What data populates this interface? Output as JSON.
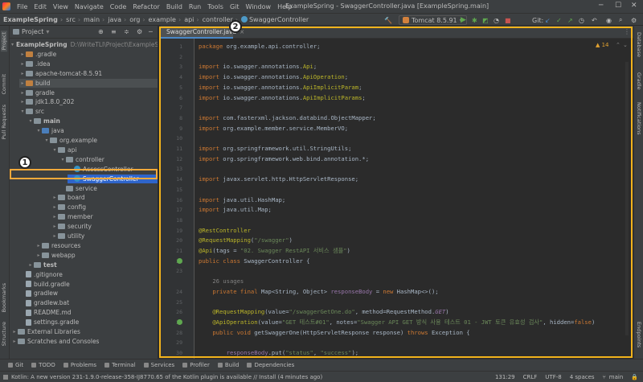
{
  "menu": {
    "items": [
      "File",
      "Edit",
      "View",
      "Navigate",
      "Code",
      "Refactor",
      "Build",
      "Run",
      "Tools",
      "Git",
      "Window",
      "Help"
    ],
    "window_title": "ExampleSpring - SwaggerController.java [ExampleSpring.main]"
  },
  "breadcrumbs": [
    "ExampleSpring",
    "src",
    "main",
    "java",
    "org",
    "example",
    "api",
    "controller",
    "SwaggerController"
  ],
  "toolbar": {
    "run_config": "Tomcat 8.5.91",
    "git_label": "Git:"
  },
  "project": {
    "title": "Project",
    "tree": [
      {
        "label": "ExampleSpring",
        "extra": "D:\\WriteTLI\\Project\\ExampleSpring",
        "depth": 0,
        "arrow": "▾",
        "icon": "folder",
        "bold": true
      },
      {
        "label": ".gradle",
        "depth": 1,
        "arrow": "▸",
        "icon": "folder-orange"
      },
      {
        "label": ".idea",
        "depth": 1,
        "arrow": "▸",
        "icon": "folder"
      },
      {
        "label": "apache-tomcat-8.5.91",
        "depth": 1,
        "arrow": "▸",
        "icon": "folder"
      },
      {
        "label": "build",
        "depth": 1,
        "arrow": "▸",
        "icon": "folder-orange",
        "selected": true
      },
      {
        "label": "gradle",
        "depth": 1,
        "arrow": "▸",
        "icon": "folder"
      },
      {
        "label": "jdk1.8.0_202",
        "depth": 1,
        "arrow": "▸",
        "icon": "folder"
      },
      {
        "label": "src",
        "depth": 1,
        "arrow": "▾",
        "icon": "folder"
      },
      {
        "label": "main",
        "depth": 2,
        "arrow": "▾",
        "icon": "folder",
        "bold": true
      },
      {
        "label": "java",
        "depth": 3,
        "arrow": "▾",
        "icon": "folder-blue"
      },
      {
        "label": "org.example",
        "depth": 4,
        "arrow": "▾",
        "icon": "folder"
      },
      {
        "label": "api",
        "depth": 5,
        "arrow": "▾",
        "icon": "folder"
      },
      {
        "label": "controller",
        "depth": 6,
        "arrow": "▾",
        "icon": "folder"
      },
      {
        "label": "AccessController",
        "depth": 7,
        "arrow": "",
        "icon": "class"
      },
      {
        "label": "SwaggerController",
        "depth": 7,
        "arrow": "",
        "icon": "class",
        "highlight": true
      },
      {
        "label": "service",
        "depth": 6,
        "arrow": "",
        "icon": "folder"
      },
      {
        "label": "board",
        "depth": 5,
        "arrow": "▸",
        "icon": "folder"
      },
      {
        "label": "config",
        "depth": 5,
        "arrow": "▸",
        "icon": "folder"
      },
      {
        "label": "member",
        "depth": 5,
        "arrow": "▸",
        "icon": "folder"
      },
      {
        "label": "security",
        "depth": 5,
        "arrow": "▸",
        "icon": "folder"
      },
      {
        "label": "utility",
        "depth": 5,
        "arrow": "▸",
        "icon": "folder"
      },
      {
        "label": "resources",
        "depth": 3,
        "arrow": "▸",
        "icon": "folder"
      },
      {
        "label": "webapp",
        "depth": 3,
        "arrow": "▸",
        "icon": "folder"
      },
      {
        "label": "test",
        "depth": 2,
        "arrow": "▸",
        "icon": "folder",
        "bold": true
      },
      {
        "label": ".gitignore",
        "depth": 1,
        "arrow": "",
        "icon": "file"
      },
      {
        "label": "build.gradle",
        "depth": 1,
        "arrow": "",
        "icon": "file"
      },
      {
        "label": "gradlew",
        "depth": 1,
        "arrow": "",
        "icon": "file"
      },
      {
        "label": "gradlew.bat",
        "depth": 1,
        "arrow": "",
        "icon": "file"
      },
      {
        "label": "README.md",
        "depth": 1,
        "arrow": "",
        "icon": "file"
      },
      {
        "label": "settings.gradle",
        "depth": 1,
        "arrow": "",
        "icon": "file"
      },
      {
        "label": "External Libraries",
        "depth": 0,
        "arrow": "▸",
        "icon": "folder"
      },
      {
        "label": "Scratches and Consoles",
        "depth": 0,
        "arrow": "▸",
        "icon": "folder"
      }
    ]
  },
  "editor": {
    "tab_label": "SwaggerController.java",
    "warnings": "▲ 14",
    "lines": [
      {
        "n": "1",
        "html": "<span class='kw'>package</span> org.example.api.controller;"
      },
      {
        "n": "2",
        "html": ""
      },
      {
        "n": "3",
        "html": "<span class='kw'>import</span> io.swagger.annotations.<span class='ann'>Api</span>;"
      },
      {
        "n": "4",
        "html": "<span class='kw'>import</span> io.swagger.annotations.<span class='ann'>ApiOperation</span>;"
      },
      {
        "n": "5",
        "html": "<span class='kw'>import</span> io.swagger.annotations.<span class='ann'>ApiImplicitParam</span>;"
      },
      {
        "n": "6",
        "html": "<span class='kw'>import</span> io.swagger.annotations.<span class='ann'>ApiImplicitParams</span>;"
      },
      {
        "n": "7",
        "html": ""
      },
      {
        "n": "8",
        "html": "<span class='kw'>import</span> com.fasterxml.jackson.databind.ObjectMapper;"
      },
      {
        "n": "9",
        "html": "<span class='kw'>import</span> org.example.member.service.MemberVO;"
      },
      {
        "n": "10",
        "html": ""
      },
      {
        "n": "11",
        "html": "<span class='kw'>import</span> org.springframework.util.StringUtils;"
      },
      {
        "n": "12",
        "html": "<span class='kw'>import</span> org.springframework.web.bind.annotation.*;"
      },
      {
        "n": "13",
        "html": ""
      },
      {
        "n": "14",
        "html": "<span class='kw'>import</span> javax.servlet.http.HttpServletResponse;"
      },
      {
        "n": "15",
        "html": ""
      },
      {
        "n": "16",
        "html": "<span class='kw'>import</span> java.util.HashMap;"
      },
      {
        "n": "17",
        "html": "<span class='kw'>import</span> java.util.Map;"
      },
      {
        "n": "18",
        "html": ""
      },
      {
        "n": "19",
        "html": "<span class='ann'>@RestController</span>"
      },
      {
        "n": "20",
        "html": "<span class='ann'>@RequestMapping</span>(<span class='str'>\"/swagger\"</span>)"
      },
      {
        "n": "21",
        "html": "<span class='ann'>@Api</span>(tags = <span class='str'>\"02. Swagger RestAPI 서비스 샘플\"</span>)"
      },
      {
        "n": "22",
        "html": "<span class='kw'>public class</span> SwaggerController {"
      },
      {
        "n": "23",
        "html": ""
      },
      {
        "n": "",
        "html": "    <span class='cmt'>26 usages</span>"
      },
      {
        "n": "24",
        "html": "    <span class='kw'>private final</span> Map&lt;String, Object&gt; <span class='fld'>responseBody</span> = <span class='kw'>new</span> HashMap&lt;&gt;();"
      },
      {
        "n": "25",
        "html": ""
      },
      {
        "n": "26",
        "html": "    <span class='ann'>@RequestMapping</span>(value=<span class='str'>\"/swaggerGetOne.do\"</span>, method=RequestMethod.<span class='fld it'>GET</span>)"
      },
      {
        "n": "27",
        "html": "    <span class='ann'>@ApiOperation</span>(value=<span class='str'>\"GET 테스트#01\"</span>, notes=<span class='str'>\"Swagger API GET 방식 사용 테스트 01 - JWT 토큰 유효성 검사\"</span>, hidden=<span class='kw'>false</span>)"
      },
      {
        "n": "28",
        "html": "    <span class='kw'>public void</span> getSwaggerOne(HttpServletResponse response) <span class='kw'>throws</span> Exception {"
      },
      {
        "n": "29",
        "html": ""
      },
      {
        "n": "30",
        "html": "        <span class='fld'>responseBody</span>.put(<span class='str'>\"status\"</span>, <span class='str'>\"success\"</span>);"
      }
    ]
  },
  "bottom_tabs": [
    "Git",
    "TODO",
    "Problems",
    "Terminal",
    "Services",
    "Profiler",
    "Build",
    "Dependencies"
  ],
  "status": {
    "message": "Kotlin: A new version 231-1.9.0-release-358-IJ8770.65 of the Kotlin plugin is available // Install (4 minutes ago)",
    "position": "131:29",
    "line_sep": "CRLF",
    "encoding": "UTF-8",
    "indent": "4 spaces",
    "branch": "main"
  },
  "side_tabs_left": [
    "Project",
    "Commit",
    "Pull Requests",
    "Bookmarks",
    "Structure"
  ],
  "side_tabs_right": [
    "Database",
    "Gradle",
    "Notifications",
    "Endpoints"
  ],
  "callouts": [
    "1",
    "2"
  ],
  "colors": {
    "highlight": "#f2a93b",
    "accent": "#4a88c7"
  }
}
